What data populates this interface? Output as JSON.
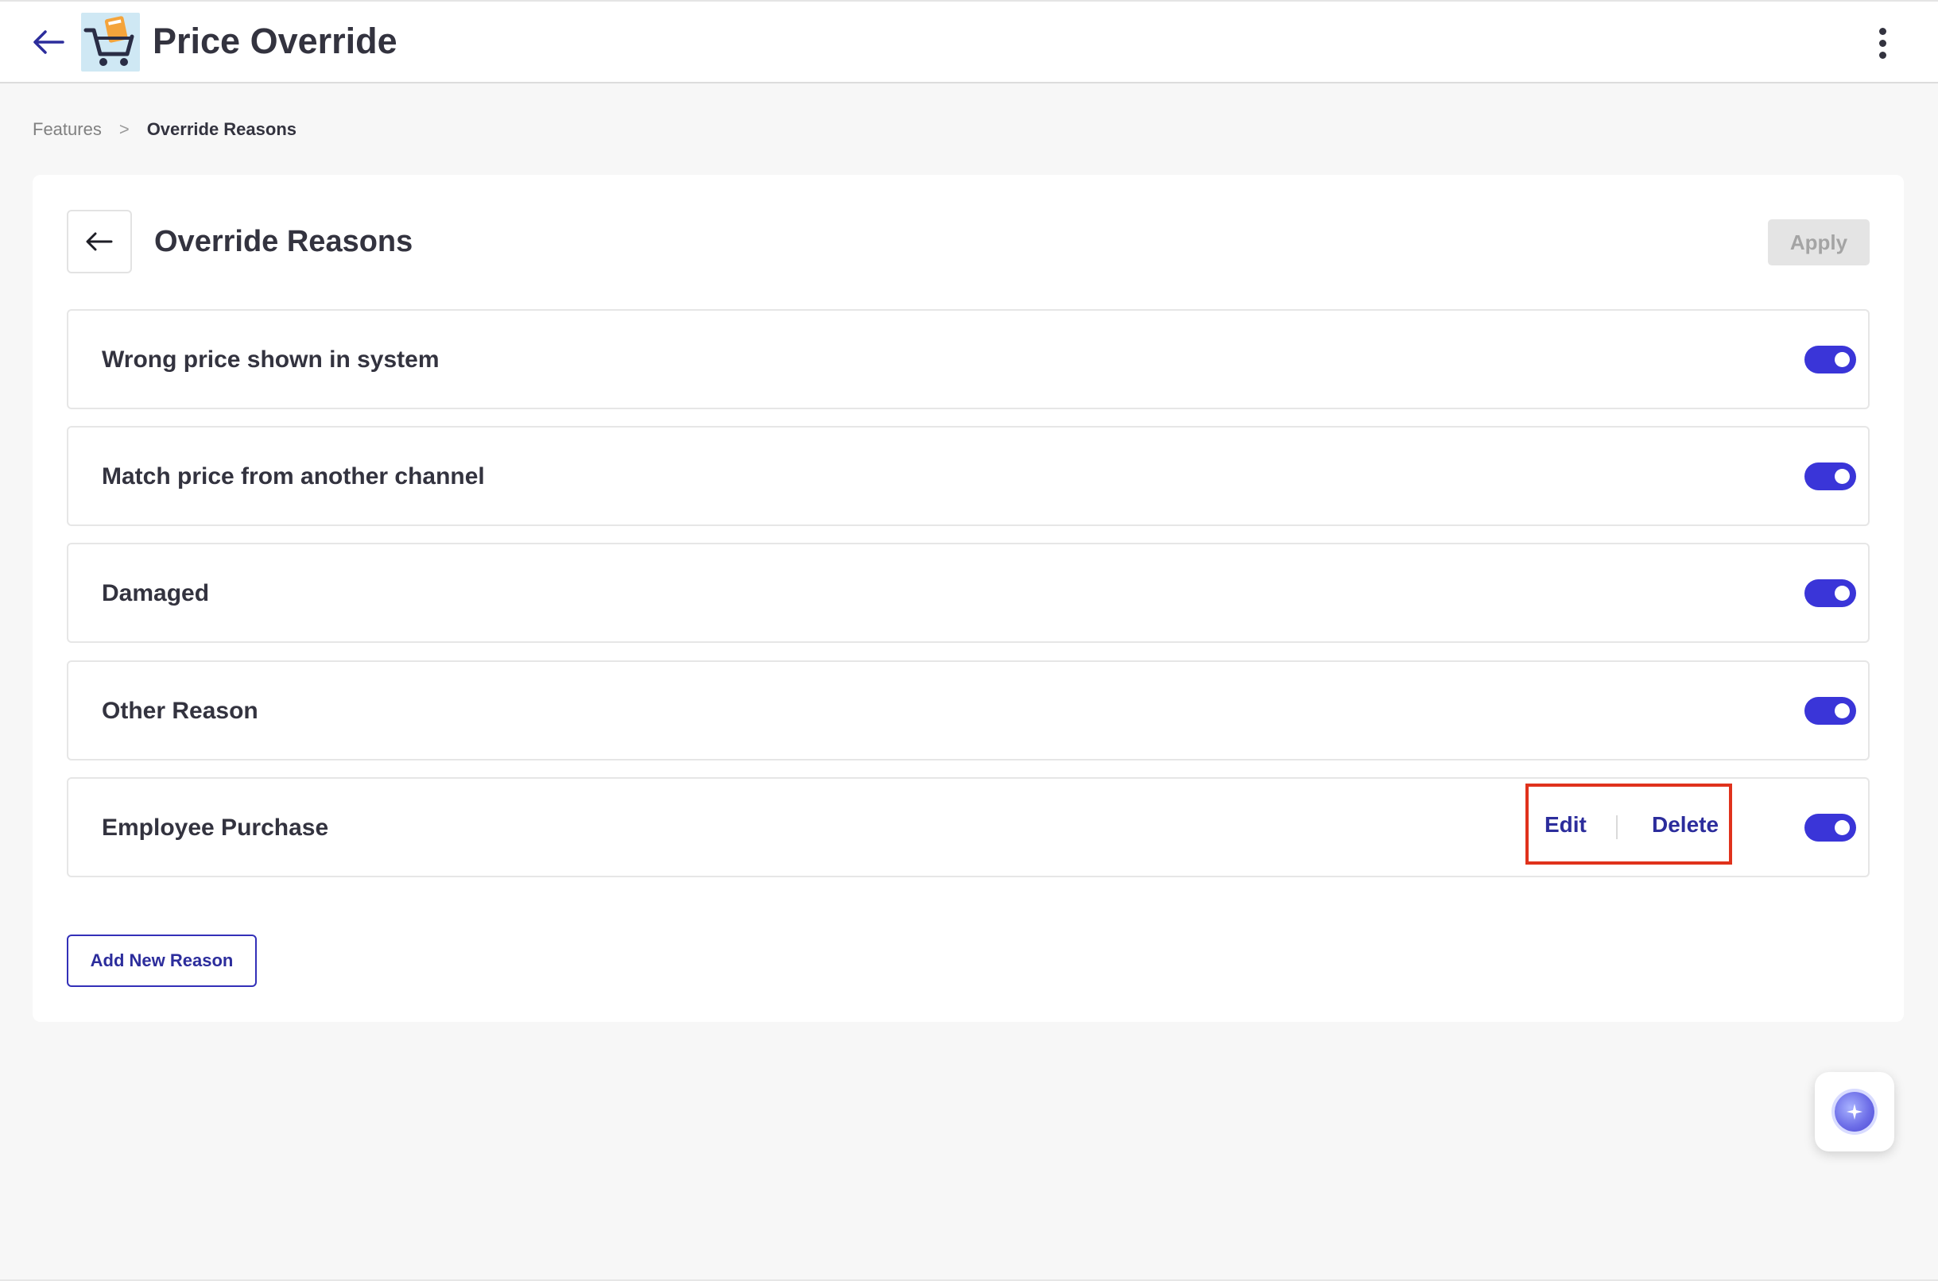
{
  "header": {
    "title": "Price Override"
  },
  "breadcrumb": {
    "items": [
      "Features",
      "Override Reasons"
    ],
    "separator": ">"
  },
  "panel": {
    "title": "Override Reasons",
    "apply_label": "Apply"
  },
  "reasons": [
    {
      "label": "Wrong price shown in system",
      "enabled": true
    },
    {
      "label": "Match price from another channel",
      "enabled": true
    },
    {
      "label": "Damaged",
      "enabled": true
    },
    {
      "label": "Other Reason",
      "enabled": true
    },
    {
      "label": "Employee Purchase",
      "enabled": true,
      "edit_label": "Edit",
      "delete_label": "Delete"
    }
  ],
  "add_reason_label": "Add New Reason",
  "colors": {
    "accent": "#3a35d8",
    "link": "#2c2d9c",
    "highlight_box": "#e0321c",
    "apply_disabled_bg": "#e4e4e4"
  }
}
